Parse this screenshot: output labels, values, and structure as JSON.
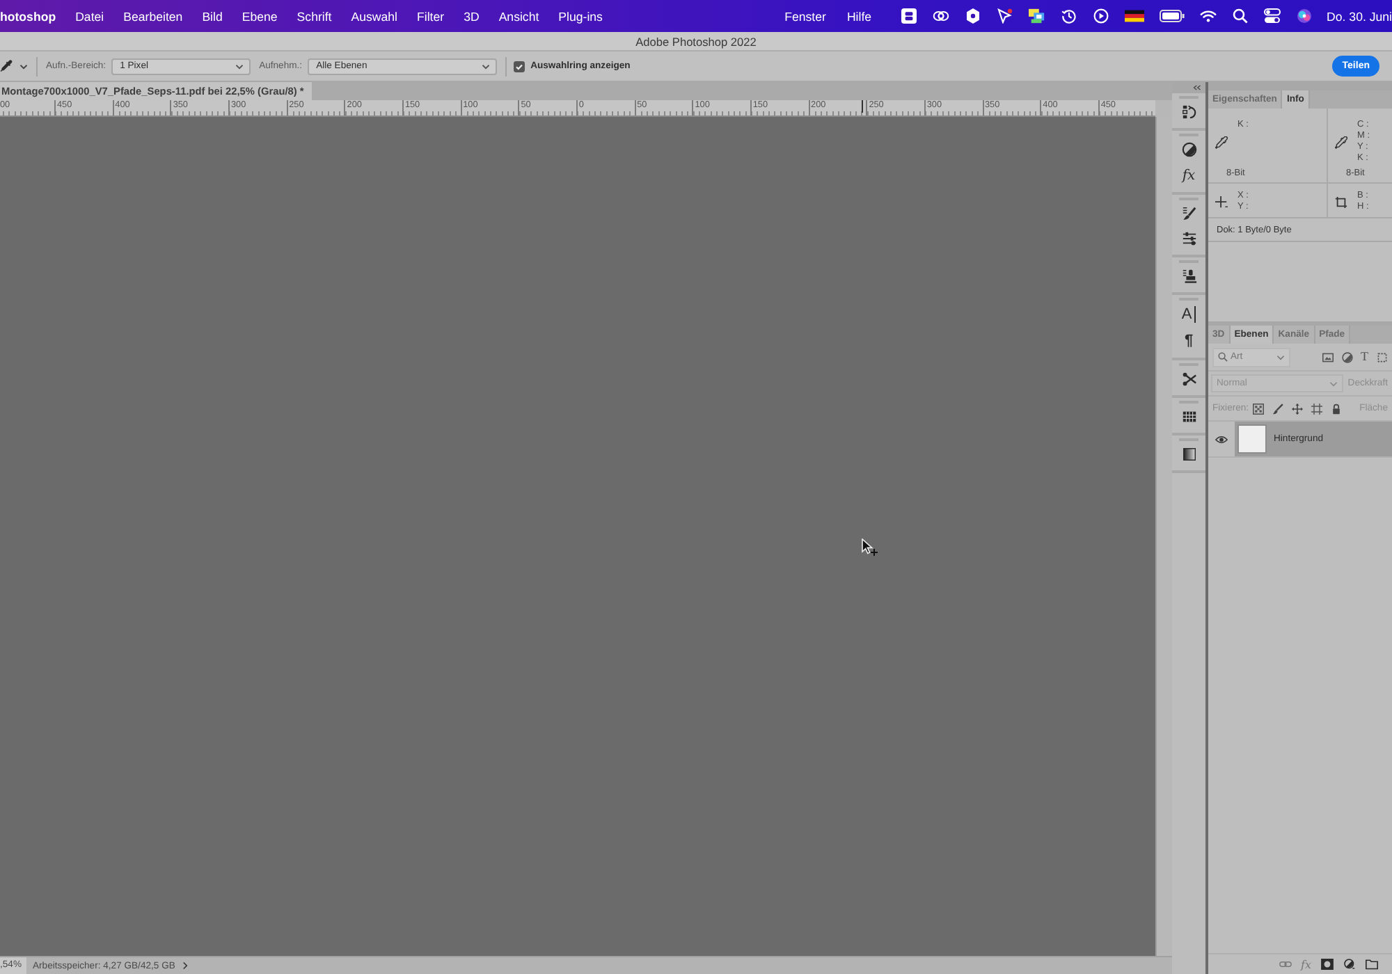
{
  "menu_bar": {
    "app_name": "hotoshop",
    "menus": [
      "Datei",
      "Bearbeiten",
      "Bild",
      "Ebene",
      "Schrift",
      "Auswahl",
      "Filter",
      "3D",
      "Ansicht",
      "Plug-ins"
    ],
    "right_menus": [
      "Fenster",
      "Hilfe"
    ],
    "clock": "Do. 30. Juni"
  },
  "window": {
    "title": "Adobe Photoshop 2022"
  },
  "options_bar": {
    "sample_size": {
      "label": "Aufn.-Bereich:",
      "value": "1 Pixel"
    },
    "sample": {
      "label": "Aufnehm.:",
      "value": "Alle Ebenen"
    },
    "show_ring": {
      "label": "Auswahlring anzeigen",
      "checked": true
    },
    "share_button": "Teilen"
  },
  "document_tab": {
    "title": "Montage700x1000_V7_Pfade_Seps-11.pdf bei 22,5% (Grau/8) *"
  },
  "ruler": {
    "labels": [
      "00",
      "450",
      "400",
      "350",
      "300",
      "250",
      "200",
      "150",
      "100",
      "50",
      "0",
      "50",
      "100",
      "150",
      "200",
      "250",
      "300",
      "350",
      "400",
      "450"
    ]
  },
  "panel_strip": {
    "styles_label": "fx",
    "character_label": "A",
    "paragraph_label": "¶"
  },
  "info_panel": {
    "tabs": [
      {
        "label": "Eigenschaften",
        "selected": false
      },
      {
        "label": "Info",
        "selected": true
      }
    ],
    "color_readouts": [
      {
        "labels": [
          "K :"
        ],
        "bit_depth": "8-Bit"
      },
      {
        "labels": [
          "C :",
          "M :",
          "Y :",
          "K :"
        ],
        "bit_depth": "8-Bit"
      }
    ],
    "position_labels": [
      "X :",
      "Y :"
    ],
    "size_labels": [
      "B :",
      "H :"
    ],
    "document_info": "Dok: 1 Byte/0 Byte"
  },
  "layers_panel": {
    "tabs": [
      {
        "label": "3D",
        "selected": false
      },
      {
        "label": "Ebenen",
        "selected": true
      },
      {
        "label": "Kanäle",
        "selected": false
      },
      {
        "label": "Pfade",
        "selected": false
      }
    ],
    "filter_kind": "Art",
    "type_filter_label": "T",
    "blend_mode": "Normal",
    "opacity_label": "Deckkraft",
    "blending_disabled": true,
    "lock_label": "Fixieren:",
    "fill_label": "Fläche",
    "layers": [
      {
        "name": "Hintergrund",
        "visible": true,
        "selected": true
      }
    ],
    "style_button": "fx"
  },
  "status_bar": {
    "zoom": ",54%",
    "memory": "Arbeitsspeicher: 4,27 GB/42,5 GB"
  }
}
